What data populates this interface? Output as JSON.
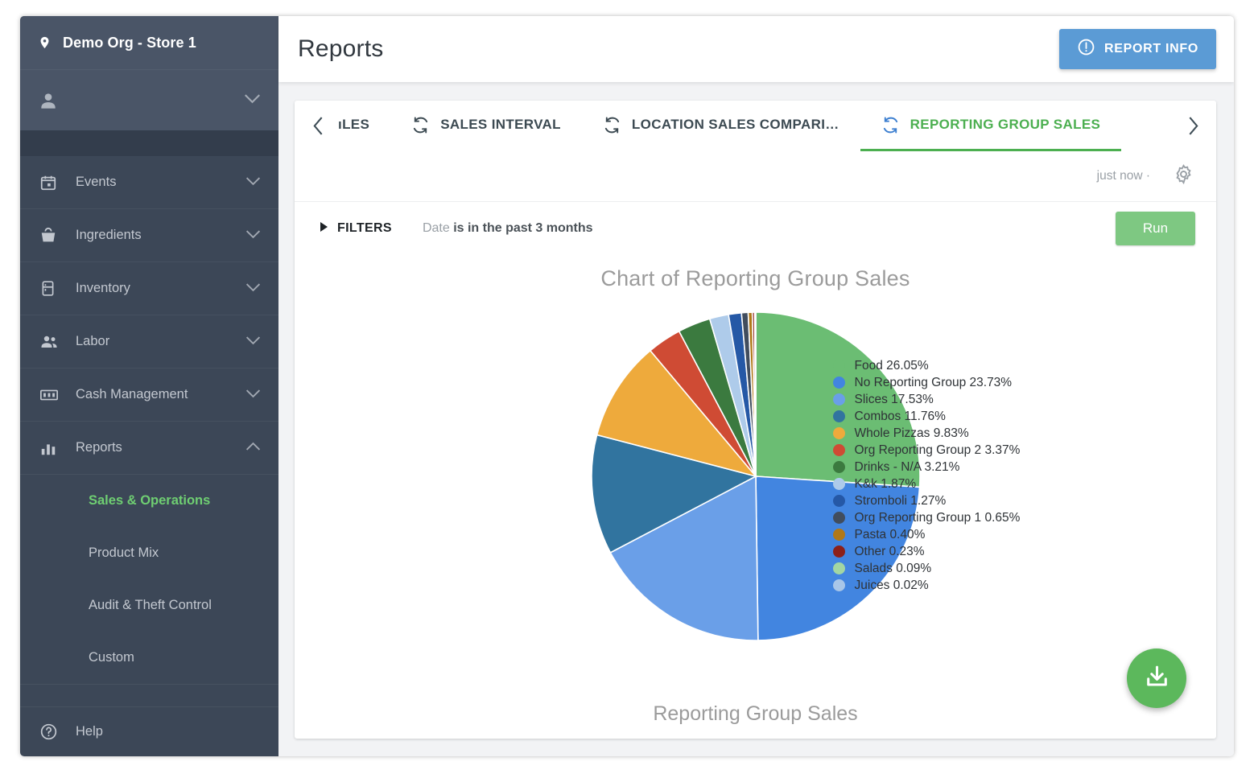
{
  "sidebar": {
    "org_label": "Demo Org - Store 1",
    "org_icon": "location-pin-icon",
    "user_icon": "person-icon",
    "items": [
      {
        "label": "Events",
        "icon": "calendar-icon",
        "expanded": false
      },
      {
        "label": "Ingredients",
        "icon": "basket-icon",
        "expanded": false
      },
      {
        "label": "Inventory",
        "icon": "fridge-icon",
        "expanded": false
      },
      {
        "label": "Labor",
        "icon": "people-icon",
        "expanded": false
      },
      {
        "label": "Cash Management",
        "icon": "cash-drawer-icon",
        "expanded": false
      },
      {
        "label": "Reports",
        "icon": "bar-chart-icon",
        "expanded": true
      }
    ],
    "reports_subitems": [
      {
        "label": "Sales & Operations",
        "active": true
      },
      {
        "label": "Product Mix",
        "active": false
      },
      {
        "label": "Audit & Theft Control",
        "active": false
      },
      {
        "label": "Custom",
        "active": false
      }
    ],
    "help_label": "Help",
    "help_icon": "question-circle-icon"
  },
  "header": {
    "title": "Reports",
    "report_info_label": "REPORT INFO",
    "report_info_icon": "exclamation-circle-icon",
    "report_info_color": "#5b9bd5"
  },
  "tabs": {
    "prev_icon": "chevron-left-icon",
    "next_icon": "chevron-right-icon",
    "items": [
      {
        "label": "ıLES",
        "icon": "sync-icon",
        "active": false
      },
      {
        "label": "SALES INTERVAL",
        "icon": "sync-icon",
        "active": false
      },
      {
        "label": "LOCATION SALES COMPARI…",
        "icon": "sync-icon",
        "active": false
      },
      {
        "label": "REPORTING GROUP SALES",
        "icon": "sync-icon",
        "active": true
      }
    ],
    "active_color": "#4caf50"
  },
  "meta": {
    "timestamp": "just now ·",
    "settings_icon": "gear-icon"
  },
  "filters": {
    "toggle_label": "FILTERS",
    "toggle_icon": "triangle-right-icon",
    "field_label": "Date",
    "condition": "is in the past 3 months",
    "run_label": "Run",
    "run_color": "#7ec882"
  },
  "chart_data": {
    "type": "pie",
    "title": "Chart of Reporting Group Sales",
    "footer_label": "Reporting Group Sales",
    "legend_position": "right",
    "unit": "%",
    "categories": [
      "Food",
      "No Reporting Group",
      "Slices",
      "Combos",
      "Whole Pizzas",
      "Org Reporting Group 2",
      "Drinks - N/A",
      "K&k",
      "Stromboli",
      "Org Reporting Group 1",
      "Pasta",
      "Other",
      "Salads",
      "Juices"
    ],
    "values": [
      26.05,
      23.73,
      17.53,
      11.76,
      9.83,
      3.37,
      3.21,
      1.87,
      1.27,
      0.65,
      0.4,
      0.23,
      0.09,
      0.02
    ],
    "colors": [
      "#6bbd73",
      "#4285e0",
      "#6a9fe8",
      "#31749f",
      "#eeaa3c",
      "#cf4b34",
      "#3b7a3f",
      "#aecbea",
      "#2558a6",
      "#414d5e",
      "#b07818",
      "#8c2019",
      "#a2d6a3",
      "#a8c6e8"
    ],
    "legend_entries": [
      "Food 26.05%",
      "No Reporting Group 23.73%",
      "Slices 17.53%",
      "Combos 11.76%",
      "Whole Pizzas 9.83%",
      "Org Reporting Group 2 3.37%",
      "Drinks - N/A 3.21%",
      "K&k 1.87%",
      "Stromboli 1.27%",
      "Org Reporting Group 1 0.65%",
      "Pasta 0.40%",
      "Other 0.23%",
      "Salads 0.09%",
      "Juices 0.02%"
    ]
  },
  "download": {
    "icon": "download-icon",
    "color": "#5cb85c"
  }
}
